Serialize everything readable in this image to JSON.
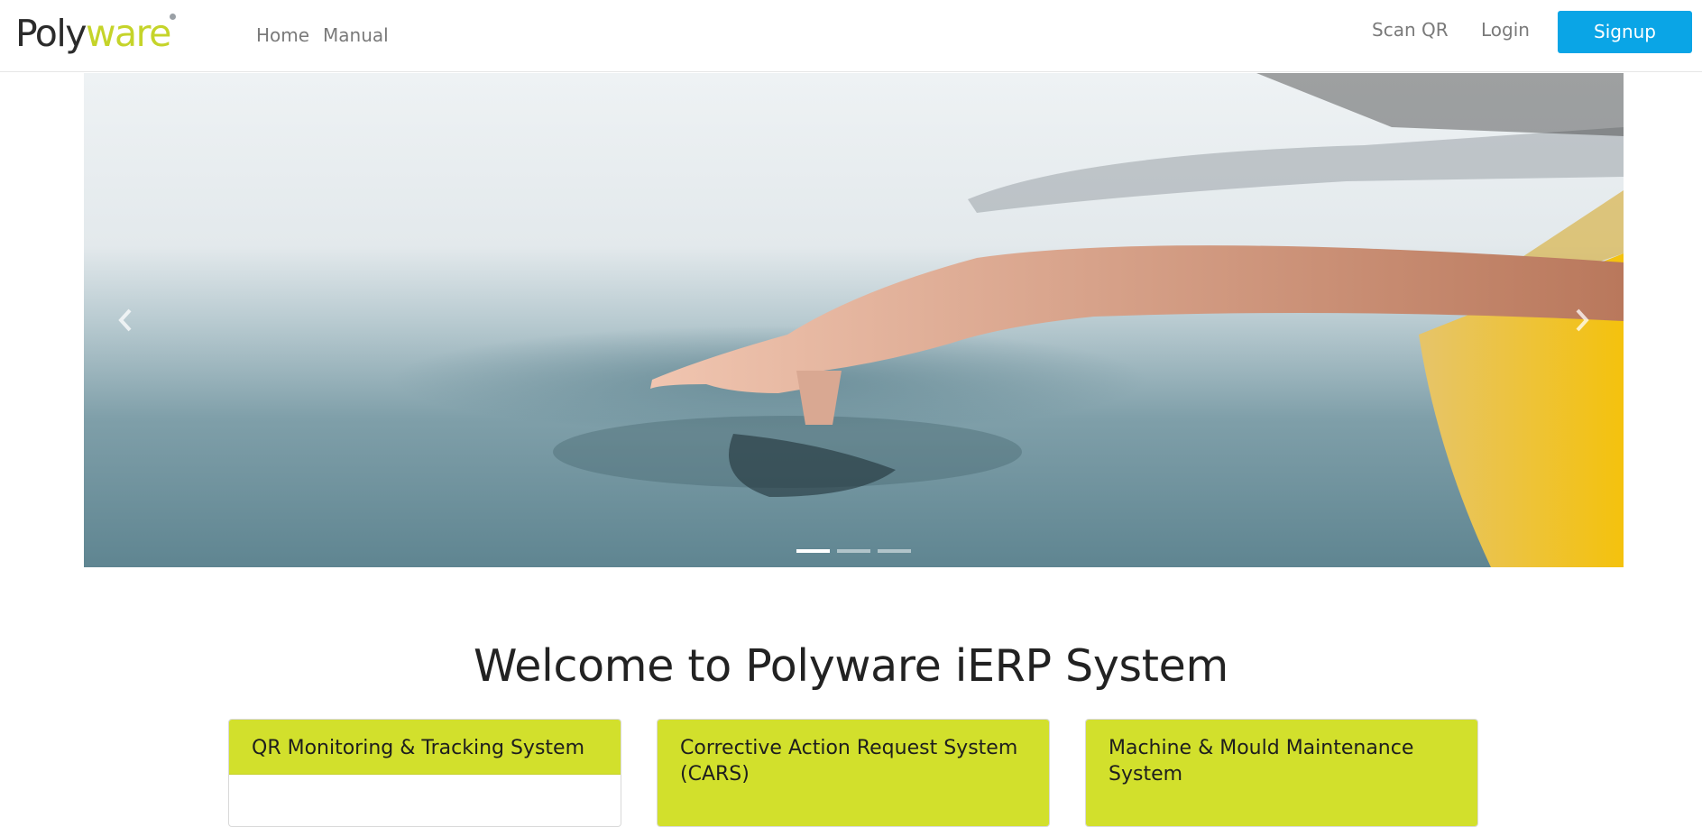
{
  "navbar": {
    "logo": {
      "part1": "Poly",
      "part2": "ware"
    },
    "links": {
      "home": "Home",
      "manual": "Manual",
      "scan_qr": "Scan QR",
      "login": "Login"
    },
    "signup_label": "Signup"
  },
  "carousel": {
    "slide_count": 3,
    "active_slide": 1,
    "image_description_icon": "hand-touching-water-photo"
  },
  "main": {
    "title": "Welcome to Polyware iERP System"
  },
  "cards": [
    {
      "title": "QR Monitoring & Tracking System"
    },
    {
      "title": "Corrective Action Request System (CARS)"
    },
    {
      "title": "Machine & Mould Maintenance System"
    }
  ],
  "colors": {
    "accent_lime": "#d2e02c",
    "signup_blue": "#0aa5e6",
    "nav_text": "#7a7a7a"
  }
}
